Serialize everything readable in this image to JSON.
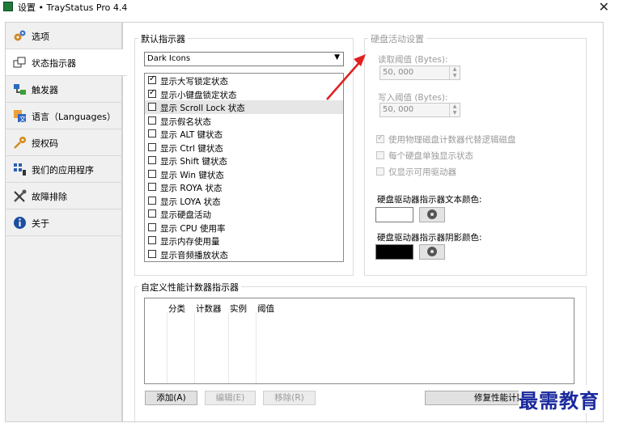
{
  "window": {
    "title": "设置 • TrayStatus Pro 4.4",
    "close": "✕"
  },
  "sidebar": {
    "items": [
      {
        "label": "选项",
        "icon": "gears-icon"
      },
      {
        "label": "状态指示器",
        "icon": "windows-icon"
      },
      {
        "label": "触发器",
        "icon": "trigger-icon"
      },
      {
        "label": "语言（Languages）",
        "icon": "language-icon"
      },
      {
        "label": "授权码",
        "icon": "key-icon"
      },
      {
        "label": "我们的应用程序",
        "icon": "apps-icon"
      },
      {
        "label": "故障排除",
        "icon": "tools-icon"
      },
      {
        "label": "关于",
        "icon": "info-icon"
      }
    ],
    "active_index": 1
  },
  "default_indicators": {
    "title": "默认指示器",
    "theme": "Dark Icons",
    "items": [
      {
        "label": "显示大写锁定状态",
        "checked": true
      },
      {
        "label": "显示小键盘锁定状态",
        "checked": true
      },
      {
        "label": "显示 Scroll Lock 状态",
        "checked": false
      },
      {
        "label": "显示假名状态",
        "checked": false
      },
      {
        "label": "显示 ALT 键状态",
        "checked": false
      },
      {
        "label": "显示 Ctrl 键状态",
        "checked": false
      },
      {
        "label": "显示 Shift 键状态",
        "checked": false
      },
      {
        "label": "显示 Win 键状态",
        "checked": false
      },
      {
        "label": "显示 ROYA 状态",
        "checked": false
      },
      {
        "label": "显示 LOYA 状态",
        "checked": false
      },
      {
        "label": "显示硬盘活动",
        "checked": false
      },
      {
        "label": "显示 CPU 使用率",
        "checked": false
      },
      {
        "label": "显示内存使用量",
        "checked": false
      },
      {
        "label": "显示音频播放状态",
        "checked": false
      }
    ],
    "selected_index": 2
  },
  "disk_settings": {
    "title": "硬盘活动设置",
    "read_label": "读取阈值 (Bytes):",
    "read_value": "50, 000",
    "write_label": "写入阈值 (Bytes):",
    "write_value": "50, 000",
    "opt1": "使用物理磁盘计数器代替逻辑磁盘",
    "opt2": "每个硬盘单独显示状态",
    "opt3": "仅显示可用驱动器",
    "text_color_label": "硬盘驱动器指示器文本颜色:",
    "shadow_color_label": "硬盘驱动器指示器阴影颜色:",
    "text_color": "#ffffff",
    "shadow_color": "#000000"
  },
  "custom_counters": {
    "title": "自定义性能计数器指示器",
    "columns": [
      "分类",
      "计数器",
      "实例",
      "阈值"
    ],
    "add": "添加(A)",
    "edit": "编辑(E)",
    "remove": "移除(R)",
    "repair": "修复性能计数"
  },
  "watermark": "最需教育",
  "colors": {
    "arrow": "#e02020",
    "watermark": "#1a2a9e"
  }
}
